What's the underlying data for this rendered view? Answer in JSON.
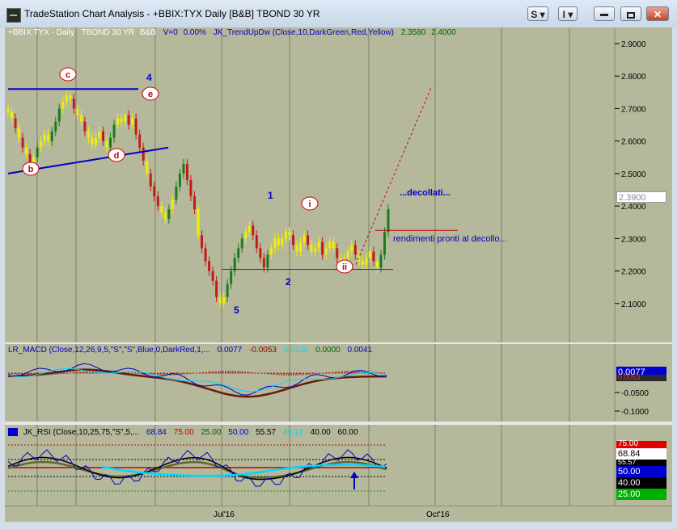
{
  "window": {
    "title": "TradeStation Chart Analysis - +BBIX:TYX Daily [B&B] TBOND 30 YR",
    "btn_s": "S",
    "btn_i": "I"
  },
  "price_header": {
    "symbol": "+BBIX:TYX - Daily",
    "desc": "TBOND 30 YR",
    "bb": "B&B",
    "volume": "V=0",
    "change": "0.00%",
    "indicator": "JK_TrendUpDw (Close,10,DarkGreen,Red,Yellow)",
    "val1": "2.3580",
    "val2": "2.4000"
  },
  "macd_header": {
    "name": "LR_MACD (Close,12,26,9,5,\"S\",\"S\",Blue,0,DarkRed,1,...",
    "v1": "0.0077",
    "v2": "-0.0053",
    "v3": "0.0130",
    "v4": "0.0000",
    "v5": "0.0041"
  },
  "rsi_header": {
    "name": "JK_RSI (Close,10,25,75,\"S\",5,...",
    "v1": "68.84",
    "v2": "75.00",
    "v3": "25.00",
    "v4": "50.00",
    "v5": "55.57",
    "v6": "49.12",
    "v7": "40.00",
    "v8": "60.00"
  },
  "price_axis": [
    "2.9000",
    "2.8000",
    "2.7000",
    "2.6000",
    "2.5000",
    "2.4000",
    "2.3000",
    "2.2000",
    "2.1000"
  ],
  "last_price": "2.3900",
  "macd_axis": [
    "-0.0500",
    "-0.1000"
  ],
  "macd_last": "0.0077",
  "macd_box2": "0.0053",
  "rsi_boxes": {
    "r75": "75.00",
    "r68": "68.84",
    "r55": "55.57",
    "r50": "50.00",
    "r40": "40.00",
    "r25": "25.00"
  },
  "x_axis": [
    "Jul'16",
    "Oct'16"
  ],
  "annotations": {
    "wave_c": "c",
    "wave_d": "d",
    "wave_e": "e",
    "wave_b": "b",
    "wave_4": "4",
    "wave_1": "1",
    "wave_2": "2",
    "wave_5": "5",
    "wave_i": "i",
    "wave_ii": "ii",
    "decollati": "...decollati...",
    "rendimenti": "rendimenti pronti al decollo..."
  },
  "chart_data": {
    "type": "candlestick",
    "symbol": "+BBIX:TYX",
    "interval": "Daily",
    "ylim": [
      2.0,
      2.9
    ],
    "last_close": 2.39,
    "colors": {
      "up": "#1d7a1d",
      "down": "#c41a1a",
      "neutral": "#f0f000",
      "trend": "#0000c8",
      "target": "#d00000"
    }
  }
}
